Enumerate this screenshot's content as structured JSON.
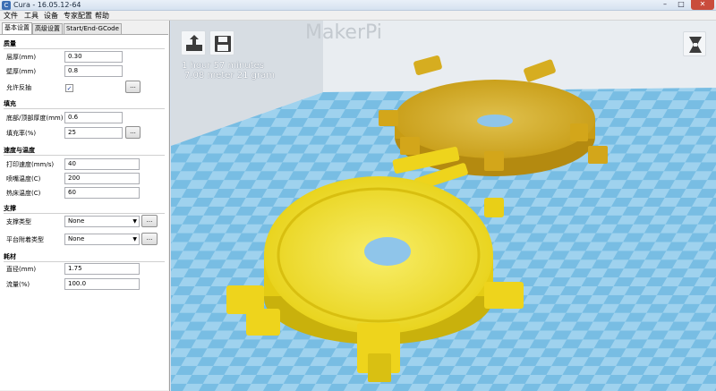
{
  "window": {
    "title": "Cura - 16.05.12-64",
    "min": "–",
    "max": "□",
    "close": "✕"
  },
  "menu": [
    "文件",
    "工具",
    "设备",
    "专家配置",
    "帮助"
  ],
  "tabs": [
    "基本设置",
    "高级设置",
    "Start/End-GCode"
  ],
  "sections": {
    "quality": {
      "title": "质量",
      "layer_height_label": "层厚(mm)",
      "layer_height": "0.30",
      "shell_label": "壁厚(mm)",
      "shell": "0.8",
      "retraction_label": "允许反抽",
      "retraction_checked": "✓"
    },
    "fill": {
      "title": "填充",
      "bottom_top_label": "底部/顶部厚度(mm)",
      "bottom_top": "0.6",
      "density_label": "填充率(%)",
      "density": "25"
    },
    "speed": {
      "title": "速度与温度",
      "print_speed_label": "打印速度(mm/s)",
      "print_speed": "40",
      "nozzle_temp_label": "喷嘴温度(C)",
      "nozzle_temp": "200",
      "bed_temp_label": "热床温度(C)",
      "bed_temp": "60"
    },
    "support": {
      "title": "支撑",
      "support_type_label": "支撑类型",
      "support_type": "None",
      "adhesion_label": "平台附着类型",
      "adhesion": "None"
    },
    "filament": {
      "title": "耗材",
      "diameter_label": "直径(mm)",
      "diameter": "1.75",
      "flow_label": "流量(%)",
      "flow": "100.0"
    }
  },
  "dots_label": "...",
  "viewport": {
    "print_time": "1 hour 57 minutes",
    "print_amount": "7.08 meter 21 gram",
    "wall_logo": "MakerPi",
    "colors": {
      "floor_light": "#9fd2ee",
      "floor_dark": "#6fb6df",
      "model_yellow": "#f2e21e",
      "model_selected": "#d8b21a"
    }
  }
}
